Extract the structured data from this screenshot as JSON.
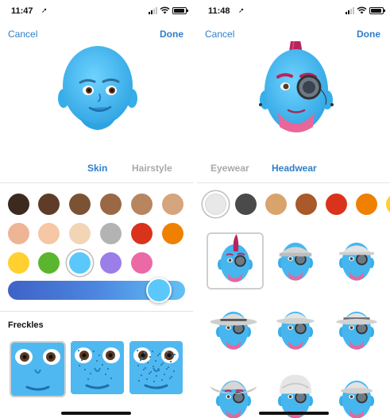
{
  "left": {
    "status": {
      "time": "11:47",
      "location_glyph": "➚"
    },
    "nav": {
      "cancel": "Cancel",
      "done": "Done"
    },
    "tabs": [
      {
        "label": "Skin",
        "active": true
      },
      {
        "label": "Hairstyle",
        "active": false
      }
    ],
    "skin_colors": [
      "#3d2a1f",
      "#5e3c27",
      "#7c5234",
      "#9a6845",
      "#b78560",
      "#d5a57e",
      "#eeb595",
      "#f5c7a4",
      "#f2d5b4",
      "#b3b3b3",
      "#d9331b",
      "#f08000",
      "#ffd02f",
      "#5cb52f",
      "#5ac8fa",
      "#9b7ee8",
      "#eb6aa6"
    ],
    "selected_skin_color": "#5ac8fa",
    "skin_tone_level": 0.86,
    "freckles": {
      "title": "Freckles",
      "options": [
        "none",
        "light",
        "heavy"
      ],
      "selected": "none"
    }
  },
  "right": {
    "status": {
      "time": "11:48",
      "location_glyph": "➚"
    },
    "nav": {
      "cancel": "Cancel",
      "done": "Done"
    },
    "tabs": [
      {
        "label": "Eyewear",
        "active": false
      },
      {
        "label": "Headwear",
        "active": true
      }
    ],
    "headwear_colors": [
      "#e8e8e8",
      "#4a4a4a",
      "#d9a46b",
      "#a9592a",
      "#d9331b",
      "#f08000",
      "#ffd02f"
    ],
    "selected_headwear_color": "#e8e8e8",
    "headwear_options": [
      "mohawk",
      "flat cap",
      "trilby",
      "wide brim hat",
      "fedora",
      "fedora with band",
      "cowboy hat",
      "turban",
      "bowler hat"
    ],
    "selected_headwear": "mohawk"
  }
}
